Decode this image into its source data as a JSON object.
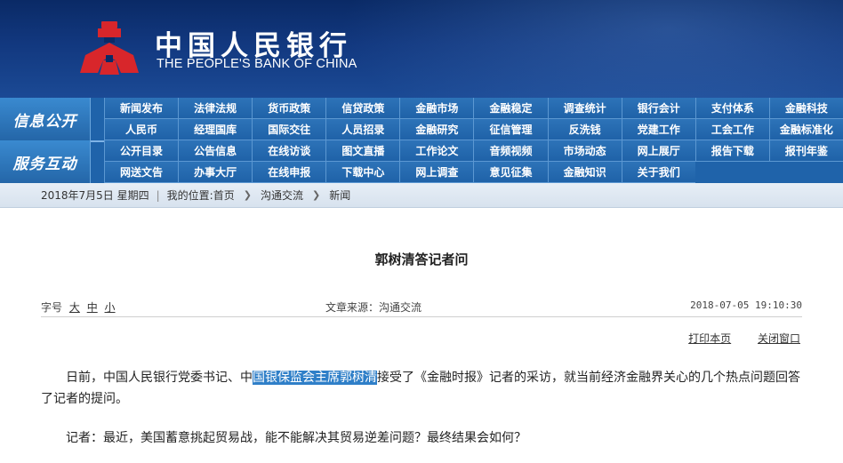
{
  "header": {
    "brand_cn": "中国人民银行",
    "brand_en": "THE PEOPLE'S BANK OF CHINA"
  },
  "nav": {
    "group1_title": "信息公开",
    "group1_items": [
      "新闻发布",
      "法律法规",
      "货币政策",
      "信贷政策",
      "金融市场",
      "金融稳定",
      "调查统计",
      "银行会计",
      "支付体系",
      "金融科技",
      "人民币",
      "经理国库",
      "国际交往",
      "人员招录",
      "金融研究",
      "征信管理",
      "反洗钱",
      "党建工作",
      "工会工作",
      "金融标准化"
    ],
    "group2_title": "服务互动",
    "group2_items": [
      "公开目录",
      "公告信息",
      "在线访谈",
      "图文直播",
      "工作论文",
      "音频视频",
      "市场动态",
      "网上展厅",
      "报告下载",
      "报刊年鉴",
      "网送文告",
      "办事大厅",
      "在线申报",
      "下载中心",
      "网上调查",
      "意见征集",
      "金融知识",
      "关于我们"
    ]
  },
  "breadcrumb": {
    "date": "2018年7月5日 星期四",
    "location_label": "我的位置:",
    "home": "首页",
    "level1": "沟通交流",
    "level2": "新闻"
  },
  "article": {
    "title": "郭树清答记者问",
    "font_label": "字号",
    "font_large": "大",
    "font_medium": "中",
    "font_small": "小",
    "source": "文章来源：沟通交流",
    "datetime": "2018-07-05 19:10:30",
    "print_label": "打印本页",
    "close_label": "关闭窗口",
    "p1_before": "日前，中国人民银行党委书记、中",
    "p1_highlight": "国银保监会主席郭树清",
    "p1_after": "接受了《金融时报》记者的采访，就当前经济金融界关心的几个热点问题回答了记者的提问。",
    "p2": "记者：最近，美国蓄意挑起贸易战，能不能解决其贸易逆差问题？最终结果会如何？"
  },
  "colors": {
    "header_dark": "#0a2a66",
    "nav_blue": "#1f63aa",
    "logo_red": "#d8262b",
    "highlight": "#2f7fc8"
  }
}
